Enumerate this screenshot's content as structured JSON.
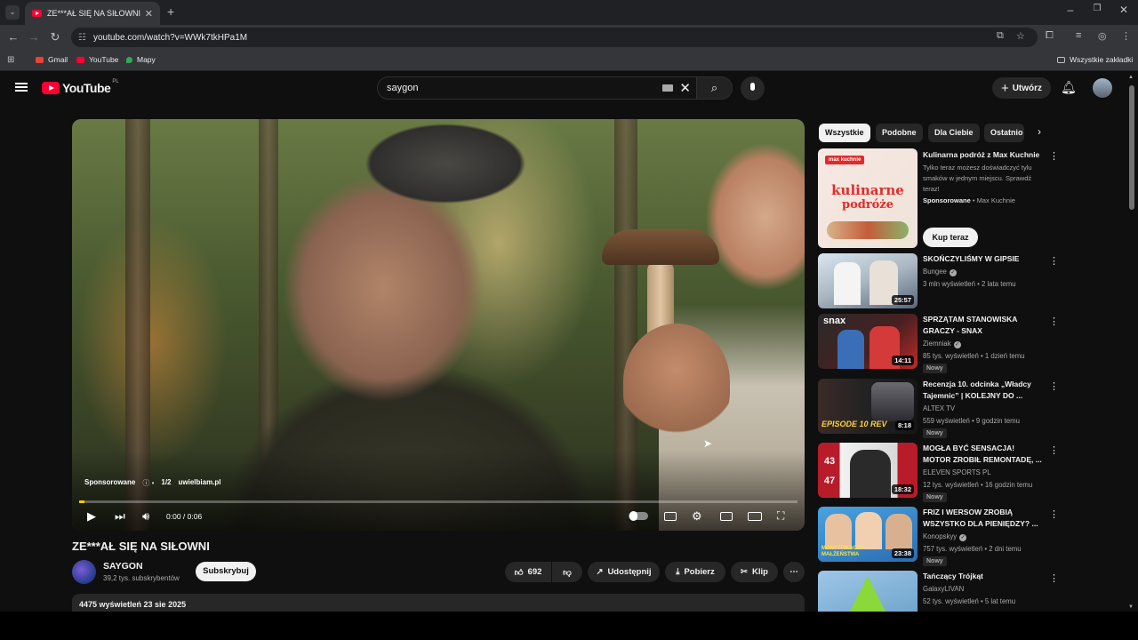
{
  "browser": {
    "tab_title": "ZE***AŁ SIĘ NA SIŁOWNI - YouTube",
    "url": "youtube.com/watch?v=WWk7tkHPa1M",
    "bookmarks": [
      "Gmail",
      "YouTube",
      "Mapy"
    ],
    "all_bookmarks": "Wszystkie zakładki"
  },
  "header": {
    "logo": "YouTube",
    "region": "PL",
    "search_value": "saygon",
    "create_label": "Utwórz"
  },
  "player": {
    "ad_label": "Sponsorowane",
    "ad_count": "1/2",
    "ad_domain": "uwielbiam.pl",
    "time": "0:00 / 0:06",
    "progress": 0.008
  },
  "video": {
    "title": "ZE***AŁ SIĘ NA SIŁOWNI",
    "channel": "SAYGON",
    "subscribers": "39,2 tys. subskrybentów",
    "subscribe_label": "Subskrybuj",
    "likes": "692",
    "share_label": "Udostępnij",
    "download_label": "Pobierz",
    "clip_label": "Klip",
    "views_date": "4475 wyświetleń  23 sie 2025"
  },
  "chips": [
    "Wszystkie",
    "Podobne",
    "Dla Ciebie",
    "Ostatnio"
  ],
  "ad": {
    "title": "Kulinarna podróż z Max Kuchnie",
    "text": "Tylko teraz możesz doświadczyć tylu smaków w jednym miejscu. Sprawdź teraz!",
    "sponsored": "Sponsorowane",
    "advertiser": "Max Kuchnie",
    "cta": "Kup teraz",
    "thumb_brand": "max kuchnie",
    "thumb_headline_1": "kulinarne",
    "thumb_headline_2": "podróże"
  },
  "recommendations": [
    {
      "title": "SKOŃCZYLIŚMY W GIPSIE",
      "channel": "Bungee",
      "verified": true,
      "meta": "3 mln wyświetleń • 2 lata temu",
      "duration": "25:57",
      "badge": "",
      "thumb_text": ""
    },
    {
      "title": "SPRZĄTAM STANOWISKA GRACZY - SNAX",
      "channel": "Ziemniak",
      "verified": true,
      "meta": "85 tys. wyświetleń • 1 dzień temu",
      "duration": "14:11",
      "badge": "Nowy",
      "thumb_text": "snax"
    },
    {
      "title": "Recenzja 10. odcinka „Władcy Tajemnic” | KOLEJNY DO ...",
      "channel": "ALTEX TV",
      "verified": false,
      "meta": "559 wyświetleń • 9 godzin temu",
      "duration": "8:18",
      "badge": "Nowy",
      "thumb_text": "EPISODE 10 REV"
    },
    {
      "title": "MOGŁA BYĆ SENSACJA! MOTOR ZROBIŁ REMONTADĘ, ...",
      "channel": "ELEVEN SPORTS PL",
      "verified": false,
      "meta": "12 tys. wyświetleń • 16 godzin temu",
      "duration": "18:32",
      "badge": "Nowy",
      "thumb_text": "43 47"
    },
    {
      "title": "FRIZ I WERSOW ZROBIĄ WSZYSTKO DLA PIENIĘDZY? ...",
      "channel": "Konopskyy",
      "verified": true,
      "meta": "757 tys. wyświetleń • 2 dni temu",
      "duration": "23:38",
      "badge": "Nowy",
      "thumb_text": "MONTYFIKACJA MAŁŻEŃSTWA"
    },
    {
      "title": "Tańczący Trójkąt",
      "channel": "GalaxyLIVAN",
      "verified": false,
      "meta": "52 tys. wyświetleń • 5 lat temu",
      "duration": "",
      "badge": "",
      "thumb_text": ""
    }
  ],
  "colors": {
    "yt_red": "#ff0033",
    "ad_progress": "#ffcc00",
    "background": "#0f0f0f",
    "surface": "#272727"
  }
}
